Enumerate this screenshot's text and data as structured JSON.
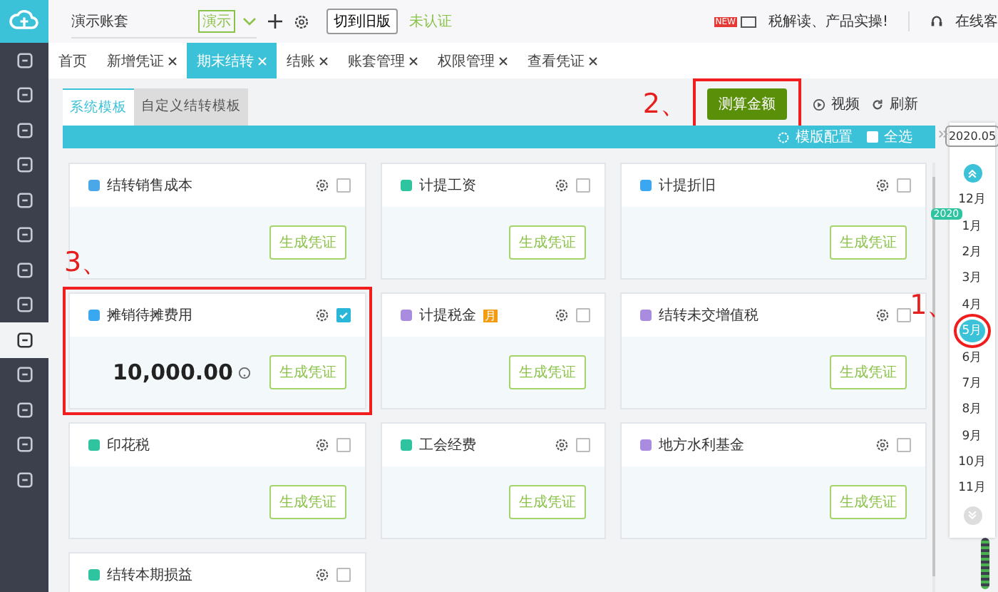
{
  "top_bar": {
    "account": "演示账套",
    "account_tag": "演示",
    "old_version_button": "切到旧版",
    "verify_status": "未认证",
    "news_badge": "NEW",
    "news": "税解读、产品实操!",
    "support": "在线客"
  },
  "sidebar": {
    "items": [
      {
        "selected": false
      },
      {
        "selected": false
      },
      {
        "selected": false
      },
      {
        "selected": false
      },
      {
        "selected": false
      },
      {
        "selected": false
      },
      {
        "selected": false
      },
      {
        "selected": false
      },
      {
        "selected": true
      },
      {
        "selected": false
      },
      {
        "selected": false
      },
      {
        "selected": false
      },
      {
        "selected": false
      }
    ]
  },
  "tabs": [
    {
      "label": "首页",
      "closable": false,
      "selected": false
    },
    {
      "label": "新增凭证",
      "closable": true,
      "selected": false
    },
    {
      "label": "期末结转",
      "closable": true,
      "selected": true
    },
    {
      "label": "结账",
      "closable": true,
      "selected": false
    },
    {
      "label": "账套管理",
      "closable": true,
      "selected": false
    },
    {
      "label": "权限管理",
      "closable": true,
      "selected": false
    },
    {
      "label": "查看凭证",
      "closable": true,
      "selected": false
    }
  ],
  "template_tabs": [
    {
      "label": "系统模板",
      "selected": true
    },
    {
      "label": "自定义结转模板",
      "selected": false
    }
  ],
  "actions": {
    "calculate_button": "测算金额",
    "video": "视频",
    "refresh": "刷新"
  },
  "toolbar": {
    "template_config": "模版配置",
    "select_all": "全选",
    "select_all_checked": false
  },
  "cards": [
    {
      "title": "结转销售成本",
      "color": "#4aa8e8",
      "checked": false,
      "button": "生成凭证"
    },
    {
      "title": "计提工资",
      "color": "#2ec4a0",
      "checked": false,
      "button": "生成凭证"
    },
    {
      "title": "计提折旧",
      "color": "#3aa8f0",
      "checked": false,
      "button": "生成凭证"
    },
    {
      "title": "摊销待摊费用",
      "color": "#3aa8f0",
      "checked": true,
      "amount": "10,000.00",
      "button": "生成凭证"
    },
    {
      "title": "计提税金",
      "color": "#a98be0",
      "checked": false,
      "badge": "月",
      "button": "生成凭证"
    },
    {
      "title": "结转未交增值税",
      "color": "#a98be0",
      "checked": false,
      "button": "生成凭证"
    },
    {
      "title": "印花税",
      "color": "#2ec4a0",
      "checked": false,
      "button": "生成凭证"
    },
    {
      "title": "工会经费",
      "color": "#2ec4a0",
      "checked": false,
      "button": "生成凭证"
    },
    {
      "title": "地方水利基金",
      "color": "#a98be0",
      "checked": false,
      "button": "生成凭证"
    },
    {
      "title": "结转本期损益",
      "color": "#2ec4a0",
      "checked": false
    }
  ],
  "month_picker": {
    "value": "2020.05",
    "year": "2020",
    "months": [
      {
        "label": "12月",
        "selected": false
      },
      {
        "label": "1月",
        "selected": false
      },
      {
        "label": "2月",
        "selected": false
      },
      {
        "label": "3月",
        "selected": false
      },
      {
        "label": "4月",
        "selected": false
      },
      {
        "label": "5月",
        "selected": true
      },
      {
        "label": "6月",
        "selected": false
      },
      {
        "label": "7月",
        "selected": false
      },
      {
        "label": "8月",
        "selected": false
      },
      {
        "label": "9月",
        "selected": false
      },
      {
        "label": "10月",
        "selected": false
      },
      {
        "label": "11月",
        "selected": false
      }
    ]
  },
  "annotations": [
    "1、",
    "2、",
    "3、"
  ]
}
